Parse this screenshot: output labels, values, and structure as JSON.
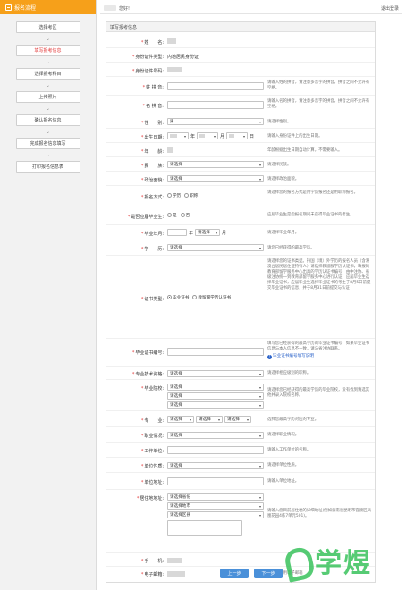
{
  "sidebar": {
    "title": "报名流程",
    "steps": [
      {
        "label": "选择考区"
      },
      {
        "label": "填写报考信息",
        "active": true
      },
      {
        "label": "选择报考科目"
      },
      {
        "label": "上传照片"
      },
      {
        "label": "确认报名信息"
      },
      {
        "label": "完成报名信息填写"
      },
      {
        "label": "打印报名信息表"
      }
    ]
  },
  "topbar": {
    "greeting": "您好!",
    "logout": "退出登录"
  },
  "panel": {
    "title": "填写报考信息"
  },
  "form": {
    "name": {
      "label": "姓　　名:"
    },
    "id_type": {
      "label": "身份证件类型:",
      "value": "内地居民身份证"
    },
    "id_no": {
      "label": "身份证件号码:"
    },
    "surname_pinyin": {
      "label": "姓 拼 音:",
      "tip": "请输入姓的拼音，请注意多音字的拼音，拼音之间不允许有空格。"
    },
    "given_pinyin": {
      "label": "名 拼 音:",
      "tip": "请输入名的拼音，请注意多音字的拼音，拼音之间不允许有空格。"
    },
    "gender": {
      "label": "性　　别:",
      "value": "男",
      "tip": "请选择性别。"
    },
    "birthdate": {
      "label": "出生日期:",
      "year_unit": "年",
      "month_unit": "月",
      "day_unit": "日",
      "tip": "请输入身份证件上的出生日期。"
    },
    "age": {
      "label": "年　　龄:",
      "tip": "年龄根据出生日期自动计算，不需要输入。"
    },
    "ethnicity": {
      "label": "民　　族:",
      "value": "请选择",
      "tip": "请选择民族。"
    },
    "political": {
      "label": "政治面貌:",
      "value": "请选择",
      "tip": "请选择政治面貌。"
    },
    "apply_method": {
      "label": "报名方式:",
      "opt1": "学历",
      "opt2": "职称",
      "tip": "请选择您的报名方式是用学历报名还是用职称报名。"
    },
    "fresh_grad": {
      "label": "是否应届毕业生:",
      "opt1": "是",
      "opt2": "否",
      "tip": "应届毕业生是指报名期间未获得毕业证书的考生。"
    },
    "grad_year": {
      "label": "毕业年月:",
      "year_unit": "年",
      "month_value": "请选择",
      "month_unit": "月",
      "tip": "请选择毕业年月。"
    },
    "education": {
      "label": "学　　历:",
      "value": "请选择",
      "tip": "请您已经获得的最高学历。"
    },
    "cert_type": {
      "label": "证书类型:",
      "opt1": "毕业证书",
      "opt2": "教留服学历认证书",
      "tip": "请选择您的证书类型。持国（境）外学历的报名人员（含港澳台居民居住证持有人）请选择教留服学历认证书，填报的教育部留学服务中心出具的学历认证书编号，由中注协、省级注协统一到教育部留学服务中心进行认证，应届毕业生选择毕业证书，应届毕业生选择毕业证书的考生于8月5日前提交毕业证书的信息，并于8月31日前提交与认证"
    },
    "cert_no": {
      "label": "毕业证书编号:",
      "tip": "填写您已经获得的最高学历的毕业证书编号，如果毕业证书信息与本人信息不一致，请与省注协联系。",
      "link": "毕业证书编号填写说明"
    },
    "title_level": {
      "label": "专业技术资格:",
      "value": "请选择",
      "tip": "请选择相应级别的职称。"
    },
    "school": {
      "label": "毕业院校:",
      "v1": "请选择",
      "v2": "请选择",
      "v3": "请选择",
      "tip": "请选择您已经获得的最高学历的毕业院校，没有找到请选其他并录入院校名称。"
    },
    "major": {
      "label": "专　　业:",
      "v1": "请选择",
      "v2": "请选择",
      "v3": "请选择",
      "tip": "选择您最高学历对应的专业。"
    },
    "occupation": {
      "label": "职业情况:",
      "value": "请选择",
      "tip": "请选择职业情况。"
    },
    "employer": {
      "label": "工作单位:",
      "tip": "请输入工作单位的名称。"
    },
    "employer_type": {
      "label": "单位性质:",
      "value": "请选择",
      "tip": "请选择单位性质。"
    },
    "employer_addr": {
      "label": "单位地址:",
      "tip": "请输入单位地址。"
    },
    "residence": {
      "label": "居住地地址:",
      "province": "请选择省份",
      "city": "请选择地市",
      "district": "请选择区县",
      "tip": "请输入您目前居住地的详细地址(例如云南省昆明市官渡区凤凰花园4栋7单元501)。"
    },
    "phone": {
      "label": "手　　机:"
    },
    "email": {
      "label": "电子邮箱:",
      "tip": "请填写常用电子邮箱"
    }
  },
  "buttons": {
    "prev": "上一步",
    "next": "下一步"
  },
  "watermark": {
    "text": "学煜"
  },
  "colors": {
    "accent": "#f6a01a",
    "link": "#2a62c9",
    "required": "#e23a3a",
    "watermark": "#39c25c"
  }
}
